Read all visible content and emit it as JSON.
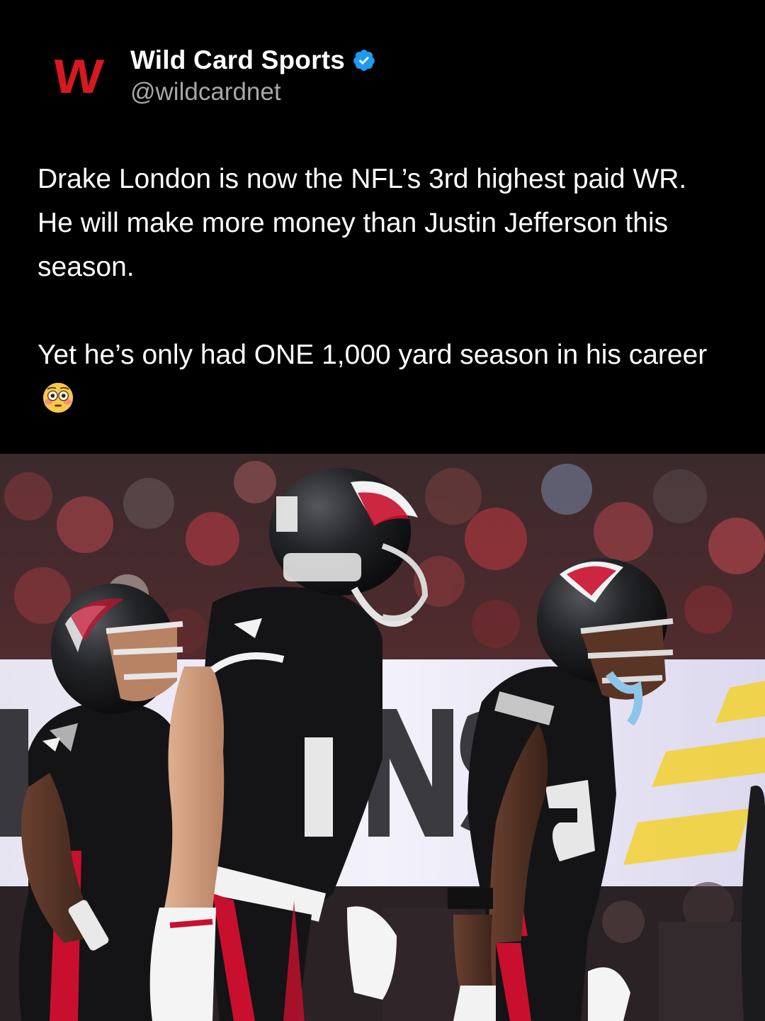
{
  "account": {
    "avatar_letter": "W",
    "name": "Wild Card Sports",
    "handle": "@wildcardnet",
    "verified": true,
    "verified_icon": "verified-badge-icon",
    "brand_color": "#d7191f",
    "verified_color": "#1d9bf0"
  },
  "post": {
    "paragraph_1": "Drake London is now the NFL’s 3rd highest paid WR. He will make more money than Justin Jefferson this season.",
    "paragraph_2": "Yet he’s only had ONE 1,000 yard season in his career",
    "emoji": "flushed-face-emoji"
  },
  "photo": {
    "subject": "football-players-photo",
    "jersey_numbers": [
      "5",
      "3"
    ],
    "team_colors": {
      "black": "#141416",
      "red": "#c8102e",
      "white": "#f2f2f2"
    }
  }
}
